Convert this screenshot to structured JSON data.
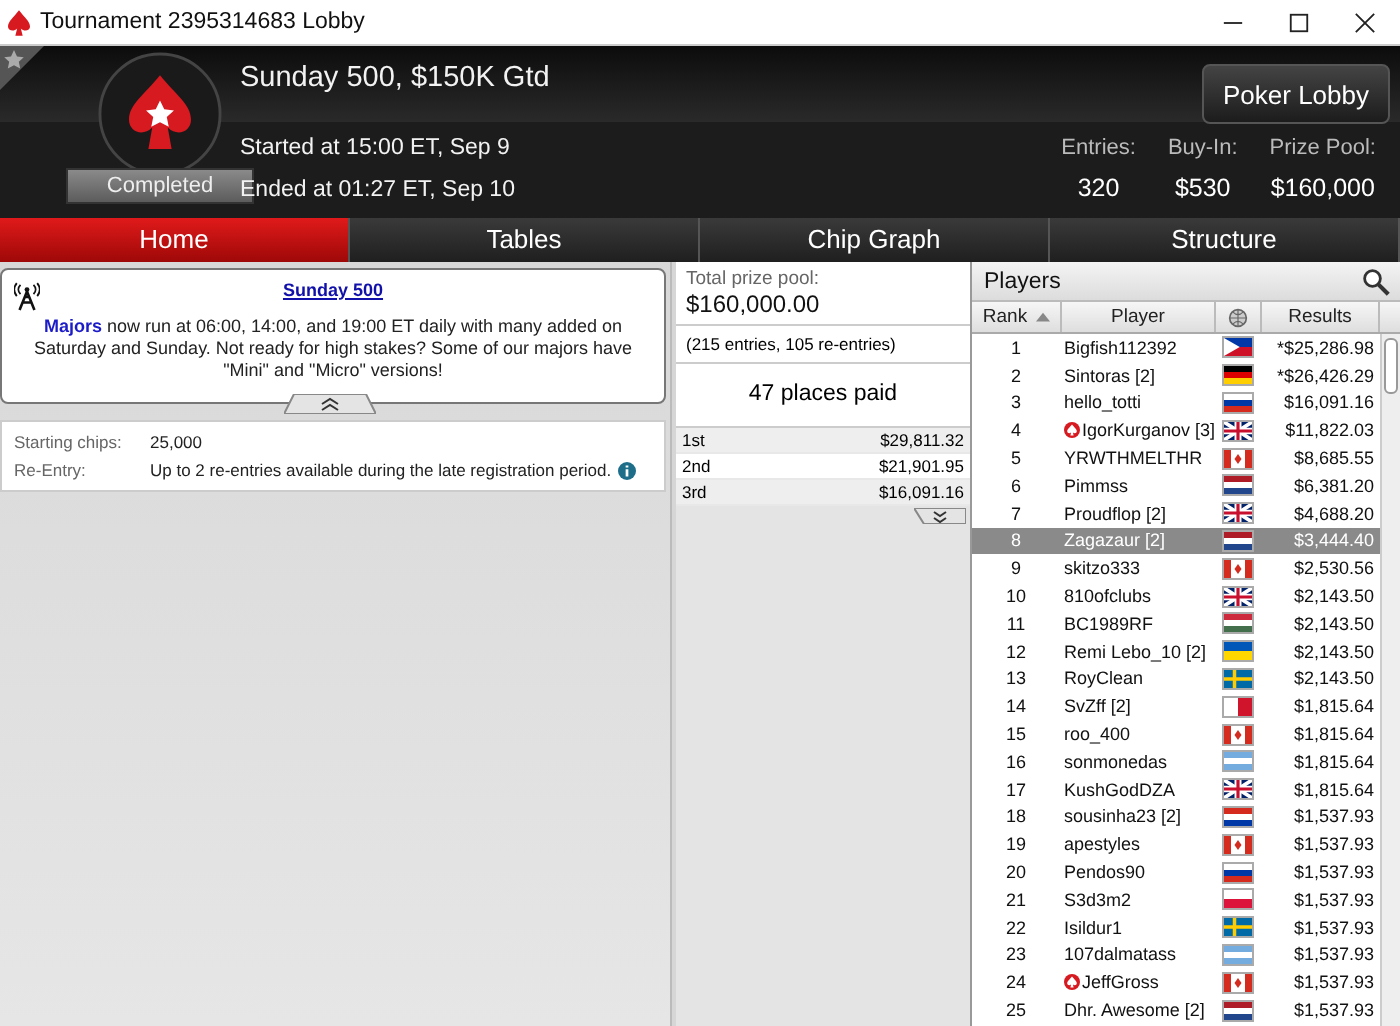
{
  "window": {
    "title": "Tournament 2395314683 Lobby"
  },
  "header": {
    "title": "Sunday 500, $150K Gtd",
    "status": "Completed",
    "started": "Started at 15:00 ET, Sep 9",
    "ended": "Ended at 01:27 ET, Sep 10",
    "lobby_button": "Poker Lobby",
    "stats": [
      {
        "label": "Entries:",
        "value": "320"
      },
      {
        "label": "Buy-In:",
        "value": "$530"
      },
      {
        "label": "Prize Pool:",
        "value": "$160,000"
      }
    ]
  },
  "tabs": [
    {
      "label": "Home",
      "selected": true
    },
    {
      "label": "Tables",
      "selected": false
    },
    {
      "label": "Chip Graph",
      "selected": false
    },
    {
      "label": "Structure",
      "selected": false
    }
  ],
  "news": {
    "title": "Sunday 500",
    "text": "**Majors** now run at 06:00, 14:00, and 19:00 ET daily with many added on Saturday and Sunday. Not ready for high stakes? Some of our majors have \"Mini\" and \"Micro\" versions!"
  },
  "details": [
    {
      "label": "Starting chips:",
      "value": "25,000",
      "info": false
    },
    {
      "label": "Re-Entry:",
      "value": "Up to 2 re-entries available during the late registration period.",
      "info": true
    }
  ],
  "prize": {
    "label": "Total prize pool:",
    "amount": "$160,000.00",
    "entries": "(215 entries, 105 re-entries)",
    "places": "47 places paid",
    "payouts": [
      {
        "place": "1st",
        "amount": "$29,811.32"
      },
      {
        "place": "2nd",
        "amount": "$21,901.95"
      },
      {
        "place": "3rd",
        "amount": "$16,091.16"
      }
    ]
  },
  "players": {
    "title": "Players",
    "columns": [
      "Rank",
      "Player",
      "Results"
    ],
    "rows": [
      {
        "rank": "1",
        "name": "Bigfish112392",
        "pro": false,
        "result": "*$25,286.98",
        "selected": false,
        "flag": {
          "kind": "triangle",
          "stripes": [
            {
              "color": "#0038a8"
            },
            {
              "color": "#ce1126"
            },
            {
              "color": "#ffffff"
            }
          ]
        }
      },
      {
        "rank": "2",
        "name": "Sintoras [2]",
        "pro": false,
        "result": "*$26,426.29",
        "selected": false,
        "flag": {
          "kind": "stripes",
          "stripes": [
            {
              "color": "#000000"
            },
            {
              "color": "#dd0000"
            },
            {
              "color": "#ffce00"
            }
          ]
        }
      },
      {
        "rank": "3",
        "name": "hello_totti",
        "pro": false,
        "result": "$16,091.16",
        "selected": false,
        "flag": {
          "kind": "stripes",
          "stripes": [
            {
              "color": "#ffffff"
            },
            {
              "color": "#0039a6"
            },
            {
              "color": "#d52b1e"
            }
          ]
        }
      },
      {
        "rank": "4",
        "name": "IgorKurganov [3]",
        "pro": true,
        "result": "$11,822.03",
        "selected": false,
        "flag": {
          "kind": "union",
          "stripes": [
            {
              "color": "#012169"
            },
            {
              "color": "#ffffff"
            },
            {
              "color": "#c8102e"
            }
          ]
        }
      },
      {
        "rank": "5",
        "name": "YRWTHMELTHR",
        "pro": false,
        "result": "$8,685.55",
        "selected": false,
        "flag": {
          "kind": "leaf",
          "stripes": [
            {
              "color": "#d52b1e"
            },
            {
              "color": "#ffffff"
            }
          ]
        }
      },
      {
        "rank": "6",
        "name": "Pimmss",
        "pro": false,
        "result": "$6,381.20",
        "selected": false,
        "flag": {
          "kind": "stripes",
          "stripes": [
            {
              "color": "#ae1c28"
            },
            {
              "color": "#ffffff"
            },
            {
              "color": "#21468b"
            }
          ]
        }
      },
      {
        "rank": "7",
        "name": "Proudflop [2]",
        "pro": false,
        "result": "$4,688.20",
        "selected": false,
        "flag": {
          "kind": "union",
          "stripes": [
            {
              "color": "#012169"
            },
            {
              "color": "#ffffff"
            },
            {
              "color": "#c8102e"
            }
          ]
        }
      },
      {
        "rank": "8",
        "name": "Zagazaur [2]",
        "pro": false,
        "result": "$3,444.40",
        "selected": true,
        "flag": {
          "kind": "stripes",
          "stripes": [
            {
              "color": "#ae1c28"
            },
            {
              "color": "#ffffff"
            },
            {
              "color": "#21468b"
            }
          ]
        }
      },
      {
        "rank": "9",
        "name": "skitzo333",
        "pro": false,
        "result": "$2,530.56",
        "selected": false,
        "flag": {
          "kind": "leaf",
          "stripes": [
            {
              "color": "#d52b1e"
            },
            {
              "color": "#ffffff"
            }
          ]
        }
      },
      {
        "rank": "10",
        "name": "810ofclubs",
        "pro": false,
        "result": "$2,143.50",
        "selected": false,
        "flag": {
          "kind": "union",
          "stripes": [
            {
              "color": "#012169"
            },
            {
              "color": "#ffffff"
            },
            {
              "color": "#c8102e"
            }
          ]
        }
      },
      {
        "rank": "11",
        "name": "BC1989RF",
        "pro": false,
        "result": "$2,143.50",
        "selected": false,
        "flag": {
          "kind": "stripes",
          "stripes": [
            {
              "color": "#cd2a3e"
            },
            {
              "color": "#ffffff"
            },
            {
              "color": "#436f4d"
            }
          ]
        }
      },
      {
        "rank": "12",
        "name": "Remi Lebo_10 [2]",
        "pro": false,
        "result": "$2,143.50",
        "selected": false,
        "flag": {
          "kind": "stripes",
          "stripes": [
            {
              "color": "#0057b7"
            },
            {
              "color": "#ffd700"
            }
          ]
        }
      },
      {
        "rank": "13",
        "name": "RoyClean",
        "pro": false,
        "result": "$2,143.50",
        "selected": false,
        "flag": {
          "kind": "nordic",
          "stripes": [
            {
              "color": "#006aa7"
            },
            {
              "color": "#fecc00"
            }
          ]
        }
      },
      {
        "rank": "14",
        "name": "SvZff [2]",
        "pro": false,
        "result": "$1,815.64",
        "selected": false,
        "flag": {
          "kind": "vertical",
          "stripes": [
            {
              "color": "#ffffff"
            },
            {
              "color": "#cf142b"
            }
          ]
        }
      },
      {
        "rank": "15",
        "name": "roo_400",
        "pro": false,
        "result": "$1,815.64",
        "selected": false,
        "flag": {
          "kind": "leaf",
          "stripes": [
            {
              "color": "#d52b1e"
            },
            {
              "color": "#ffffff"
            }
          ]
        }
      },
      {
        "rank": "16",
        "name": "sonmonedas",
        "pro": false,
        "result": "$1,815.64",
        "selected": false,
        "flag": {
          "kind": "stripes",
          "stripes": [
            {
              "color": "#74acdf"
            },
            {
              "color": "#ffffff"
            },
            {
              "color": "#74acdf"
            }
          ]
        }
      },
      {
        "rank": "17",
        "name": "KushGodDZA",
        "pro": false,
        "result": "$1,815.64",
        "selected": false,
        "flag": {
          "kind": "union",
          "stripes": [
            {
              "color": "#012169"
            },
            {
              "color": "#ffffff"
            },
            {
              "color": "#c8102e"
            }
          ]
        }
      },
      {
        "rank": "18",
        "name": "sousinha23 [2]",
        "pro": false,
        "result": "$1,537.93",
        "selected": false,
        "flag": {
          "kind": "stripes",
          "stripes": [
            {
              "color": "#d52b1e"
            },
            {
              "color": "#ffffff"
            },
            {
              "color": "#0038a8"
            }
          ]
        }
      },
      {
        "rank": "19",
        "name": "apestyles",
        "pro": false,
        "result": "$1,537.93",
        "selected": false,
        "flag": {
          "kind": "leaf",
          "stripes": [
            {
              "color": "#d52b1e"
            },
            {
              "color": "#ffffff"
            }
          ]
        }
      },
      {
        "rank": "20",
        "name": "Pendos90",
        "pro": false,
        "result": "$1,537.93",
        "selected": false,
        "flag": {
          "kind": "stripes",
          "stripes": [
            {
              "color": "#ffffff"
            },
            {
              "color": "#0039a6"
            },
            {
              "color": "#d52b1e"
            }
          ]
        }
      },
      {
        "rank": "21",
        "name": "S3d3m2",
        "pro": false,
        "result": "$1,537.93",
        "selected": false,
        "flag": {
          "kind": "stripes",
          "stripes": [
            {
              "color": "#ffffff"
            },
            {
              "color": "#dc143c"
            }
          ]
        }
      },
      {
        "rank": "22",
        "name": "Isildur1",
        "pro": false,
        "result": "$1,537.93",
        "selected": false,
        "flag": {
          "kind": "nordic",
          "stripes": [
            {
              "color": "#006aa7"
            },
            {
              "color": "#fecc00"
            }
          ]
        }
      },
      {
        "rank": "23",
        "name": "107dalmatass",
        "pro": false,
        "result": "$1,537.93",
        "selected": false,
        "flag": {
          "kind": "stripes",
          "stripes": [
            {
              "color": "#74acdf"
            },
            {
              "color": "#ffffff"
            },
            {
              "color": "#74acdf"
            }
          ]
        }
      },
      {
        "rank": "24",
        "name": "JeffGross",
        "pro": true,
        "result": "$1,537.93",
        "selected": false,
        "flag": {
          "kind": "leaf",
          "stripes": [
            {
              "color": "#d52b1e"
            },
            {
              "color": "#ffffff"
            }
          ]
        }
      },
      {
        "rank": "25",
        "name": "Dhr. Awesome [2]",
        "pro": false,
        "result": "$1,537.93",
        "selected": false,
        "flag": {
          "kind": "stripes",
          "stripes": [
            {
              "color": "#ae1c28"
            },
            {
              "color": "#ffffff"
            },
            {
              "color": "#21468b"
            }
          ]
        }
      }
    ]
  }
}
